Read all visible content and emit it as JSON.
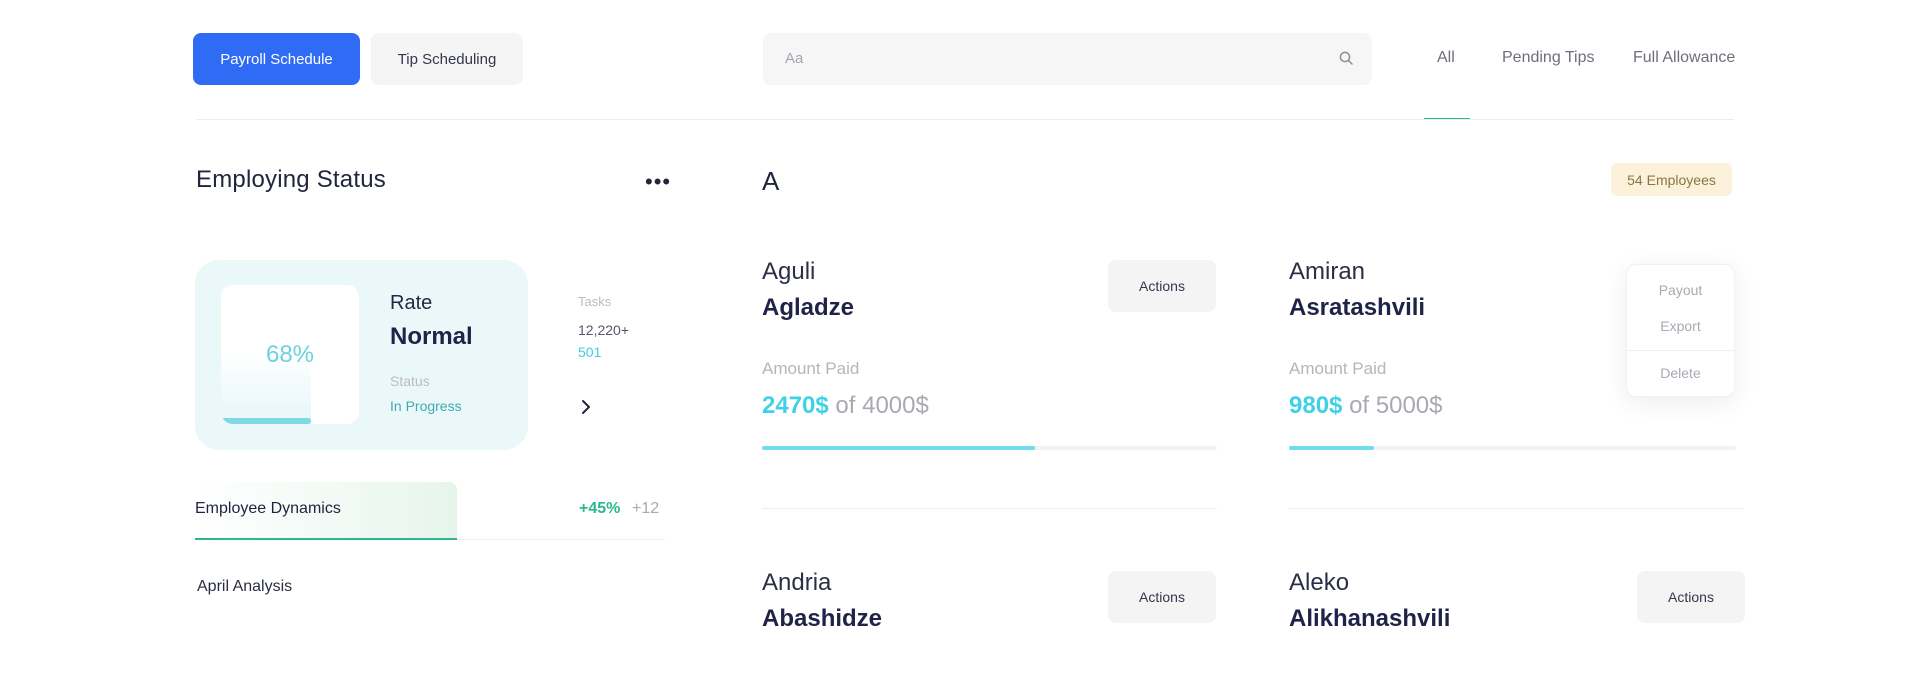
{
  "toolbar": {
    "payroll_label": "Payroll Schedule",
    "tip_label": "Tip Scheduling"
  },
  "search": {
    "placeholder": "Aa"
  },
  "tabs": [
    {
      "label": "All",
      "active": true
    },
    {
      "label": "Pending Tips",
      "active": false
    },
    {
      "label": "Full Allowance",
      "active": false
    }
  ],
  "status_panel": {
    "title": "Employing Status",
    "rate": {
      "percent_label": "68%",
      "percent_value": 0.68,
      "label": "Rate",
      "value": "Normal",
      "status_label": "Status",
      "status_value": "In Progress"
    },
    "tasks": {
      "label": "Tasks",
      "value": "12,220+",
      "sub": "501"
    },
    "dynamics": {
      "label": "Employee Dynamics",
      "percent": "+45%",
      "count": "+12"
    },
    "analysis_label": "April Analysis"
  },
  "group": {
    "letter": "A",
    "badge": "54 Employees"
  },
  "employees": [
    {
      "first": "Aguli",
      "last": "Agladze",
      "actions_label": "Actions",
      "amount_label": "Amount Paid",
      "paid": "2470$",
      "total": "of 4000$",
      "progress": 0.6
    },
    {
      "first": "Amiran",
      "last": "Asratashvili",
      "amount_label": "Amount Paid",
      "paid": "980$",
      "total": "of 5000$",
      "progress": 0.19
    },
    {
      "first": "Andria",
      "last": "Abashidze",
      "actions_label": "Actions"
    },
    {
      "first": "Aleko",
      "last": "Alikhanashvili",
      "actions_label": "Actions"
    }
  ],
  "menu": {
    "items": [
      "Payout",
      "Export",
      "Delete"
    ]
  },
  "colors": {
    "primary": "#2f6bf5",
    "accent_green": "#2cb88f",
    "accent_cyan": "#3fd2e6"
  }
}
